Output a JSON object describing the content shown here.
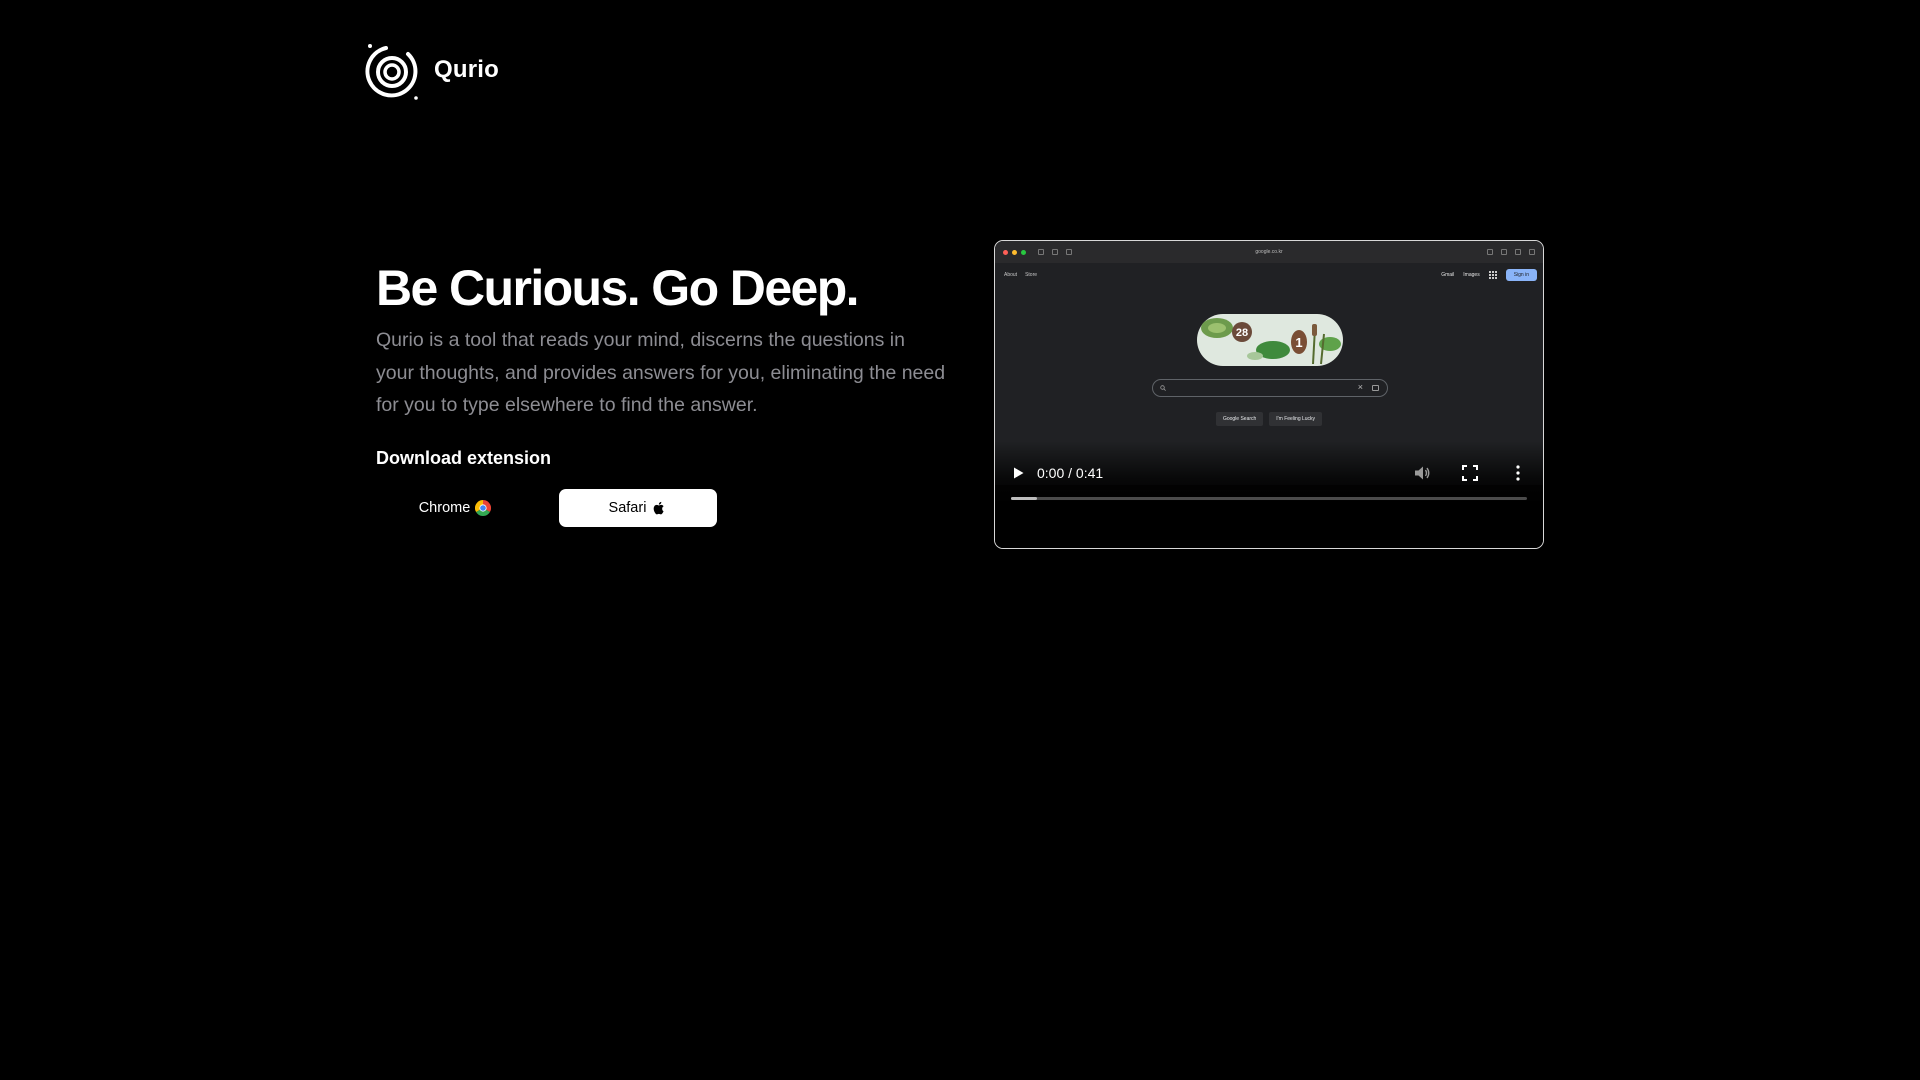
{
  "brand": {
    "name": "Qurio"
  },
  "hero": {
    "title": "Be Curious. Go Deep.",
    "description": "Qurio is a tool that reads your mind, discerns the questions in your thoughts, and provides answers for you, eliminating the need for you to type elsewhere to find the answer.",
    "download_title": "Download extension"
  },
  "buttons": {
    "chrome_label": "Chrome",
    "safari_label": "Safari"
  },
  "video": {
    "time": "0:00 / 0:41",
    "progress_fraction": 0.05,
    "screenshot": {
      "url": "google.co.kr",
      "top_left_links": [
        "About",
        "Store"
      ],
      "top_right_links": [
        "Gmail",
        "Images"
      ],
      "sign_in": "Sign in",
      "search_button": "Google Search",
      "lucky_button": "I'm Feeling Lucky",
      "doodle_numbers": [
        "28",
        "1"
      ]
    }
  },
  "colors": {
    "background": "#000000",
    "description_text": "#8d8d93",
    "safari_button_bg": "#ffffff"
  },
  "icons": {
    "logo": "qurio-spiral-logo",
    "chrome": "chrome-icon",
    "safari": "apple-icon",
    "play": "play-icon",
    "volume": "volume-icon",
    "fullscreen": "fullscreen-icon",
    "more": "more-vert-icon"
  }
}
